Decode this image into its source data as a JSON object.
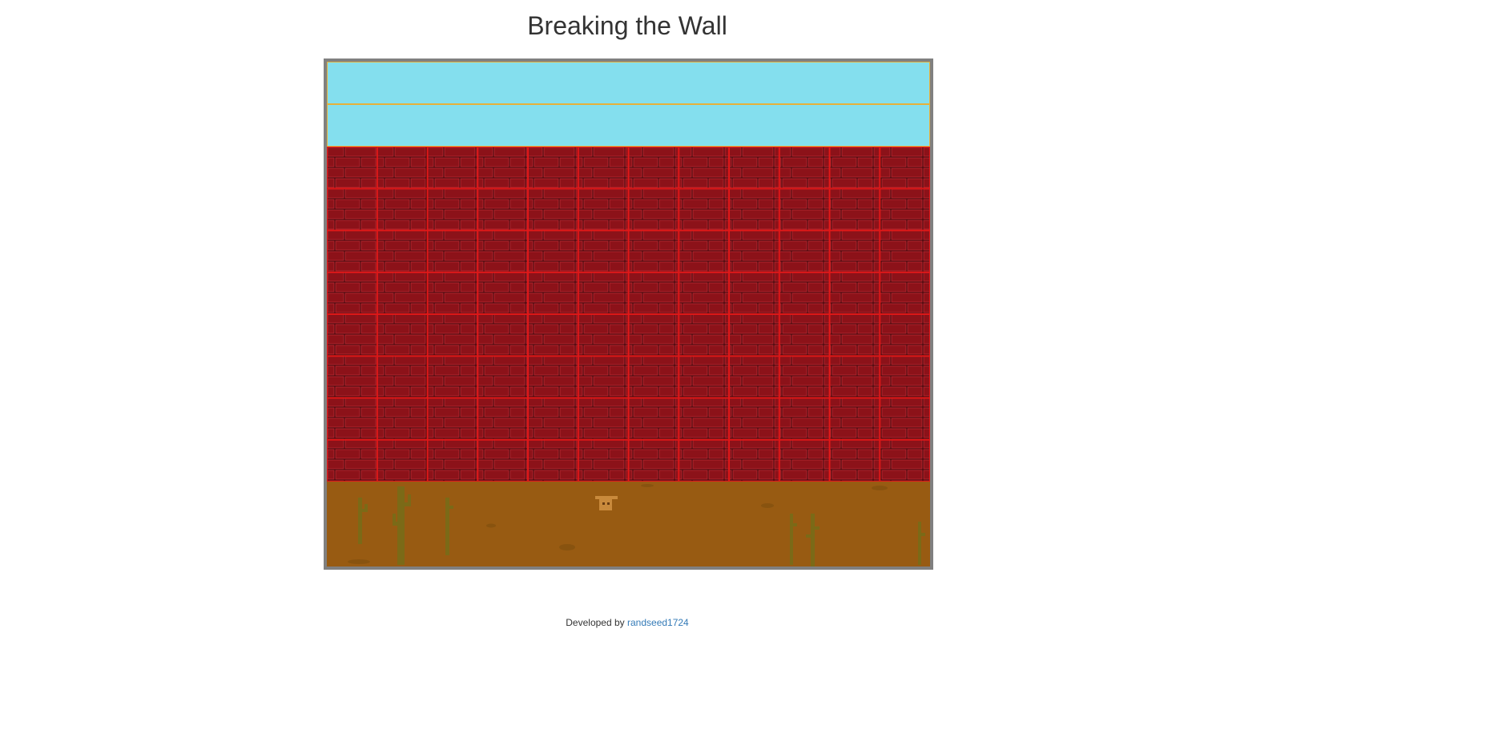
{
  "page": {
    "title": "Breaking the Wall"
  },
  "game": {
    "columns": 12,
    "wall_rows": 8,
    "sky_rows": 2
  },
  "footer": {
    "prefix": "Developed by",
    "author": "randseed1724"
  },
  "colors": {
    "sky": "#84dfee",
    "sky_border": "#e6b13a",
    "brick": "#8c1219",
    "brick_highlight": "#b01f27",
    "mortar": "#3a0608",
    "grid_line": "#e31818",
    "ground": "#985b12",
    "cactus": "#7a6a14",
    "board_border": "#808080",
    "link": "#337ab7"
  }
}
